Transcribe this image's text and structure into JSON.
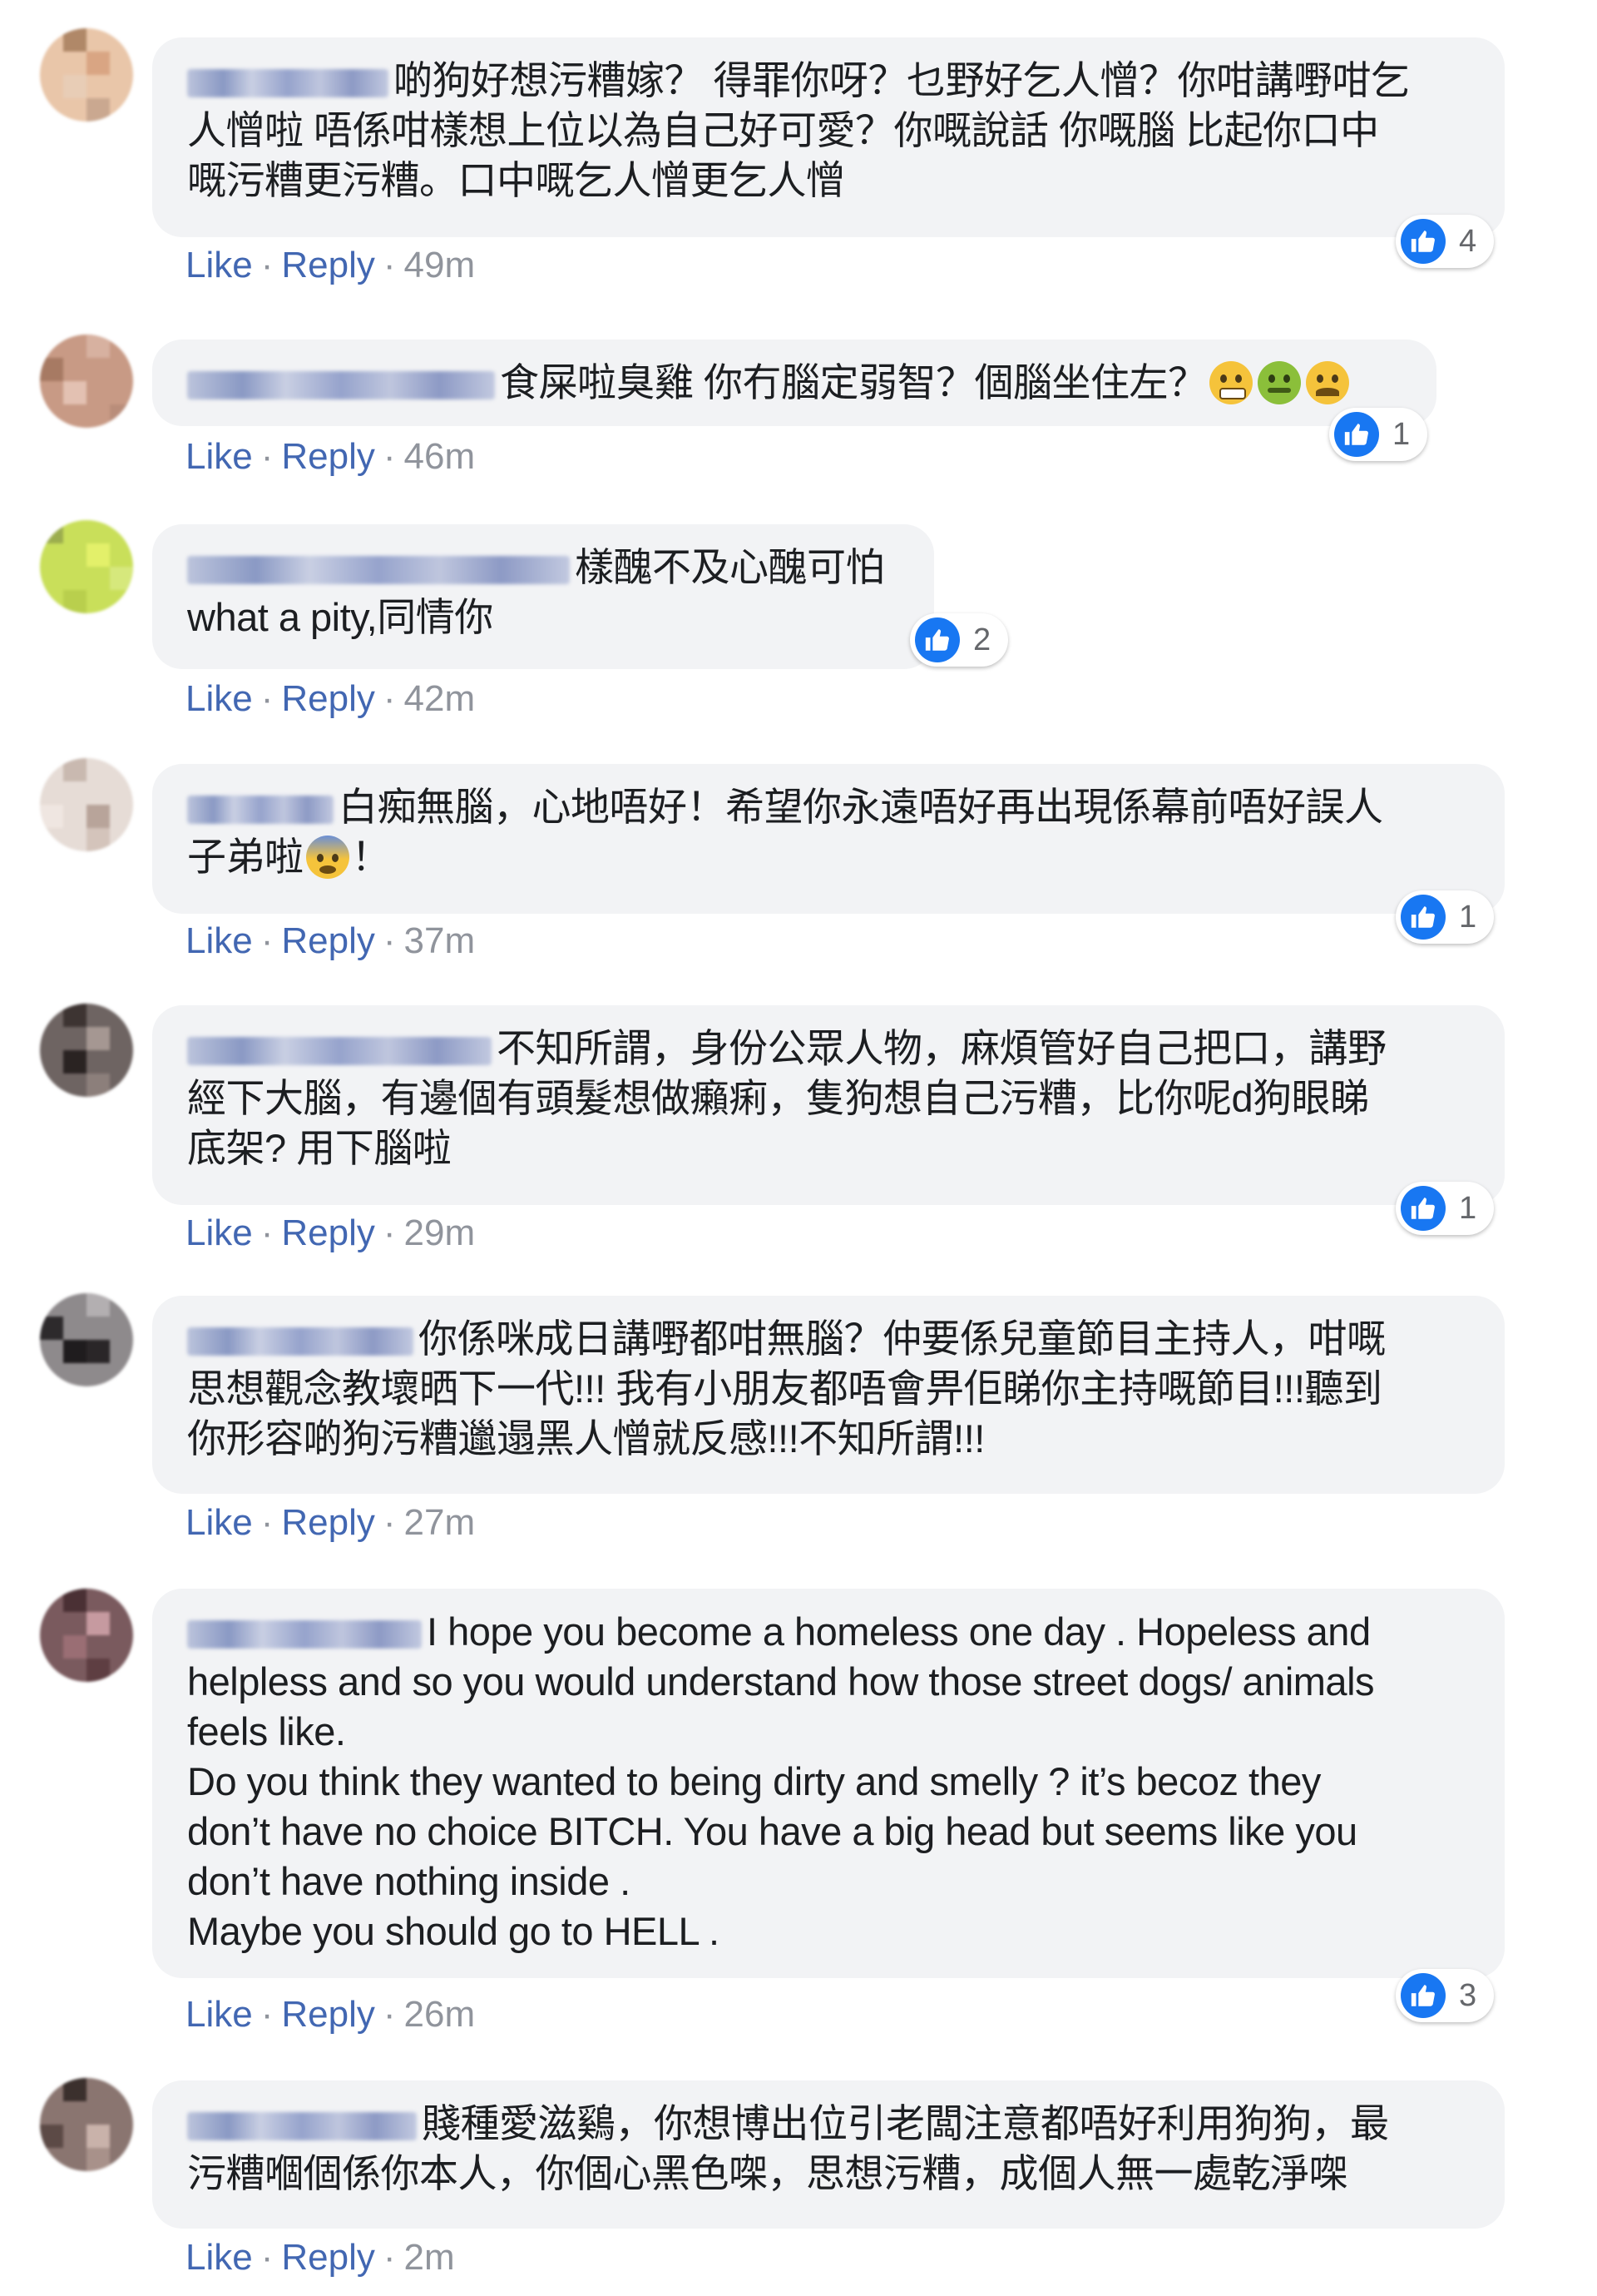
{
  "colors": {
    "link": "#4267b2",
    "meta": "#90949c",
    "bubble": "#f2f3f5",
    "like": "#1877f2"
  },
  "action_labels": {
    "like": "Like",
    "reply": "Reply",
    "separator": "·"
  },
  "comments": [
    {
      "text": "啲狗好想污糟嫁？ 得罪你呀？乜野好乞人憎？你咁講嘢咁乞\n人憎啦 唔係咁樣想上位以為自己好可愛？你嘅說話 你嘅腦 比起你口中\n嘅污糟更污糟。口中嘅乞人憎更乞人憎",
      "reactions": "4",
      "time": "49m",
      "emoji_icons": []
    },
    {
      "text": "食屎啦臭雞 你冇腦定弱智？個腦坐住左？",
      "reactions": "1",
      "time": "46m",
      "emoji_icons": [
        "grimace-emoji-icon",
        "sick-emoji-icon",
        "tired-emoji-icon"
      ]
    },
    {
      "text": "樣醜不及心醜可怕\nwhat a pity,同情你",
      "reactions": "2",
      "time": "42m",
      "emoji_icons": []
    },
    {
      "text": "白痴無腦，心地唔好！希望你永遠唔好再出現係幕前唔好誤人\n子弟啦",
      "text_after": "！",
      "reactions": "1",
      "time": "37m",
      "emoji_icons": [
        "anxious-emoji-icon"
      ]
    },
    {
      "text": "不知所謂，身份公眾人物，麻煩管好自己把口，講野\n經下大腦，有邊個有頭髮想做癩痢，隻狗想自己污糟，比你呢d狗眼睇\n底架? 用下腦啦",
      "reactions": "1",
      "time": "29m",
      "emoji_icons": []
    },
    {
      "text": "你係咪成日講嘢都咁無腦？仲要係兒童節目主持人，咁嘅\n思想觀念教壞晒下一代!!! 我有小朋友都唔會畀佢睇你主持嘅節目!!!聽到\n你形容啲狗污糟邋遢黑人憎就反感!!!不知所謂!!!",
      "reactions": "",
      "time": "27m",
      "emoji_icons": []
    },
    {
      "text": "I hope you become a homeless one day . Hopeless and\nhelpless and so you would understand how those street dogs/ animals\nfeels like.\nDo you think they wanted to being dirty and smelly ? it’s becoz they\ndon’t have no choice BITCH. You have a big head but seems like you\ndon’t have nothing inside .\nMaybe you should go to HELL .",
      "reactions": "3",
      "time": "26m",
      "emoji_icons": []
    },
    {
      "text": "賤種愛滋鷄，你想博出位引老闆注意都唔好利用狗狗，最\n污糟嗰個係你本人，你個心黑色㗎，思想污糟，成個人無一處乾淨㗎",
      "reactions": "",
      "time": "2m",
      "emoji_icons": []
    }
  ]
}
